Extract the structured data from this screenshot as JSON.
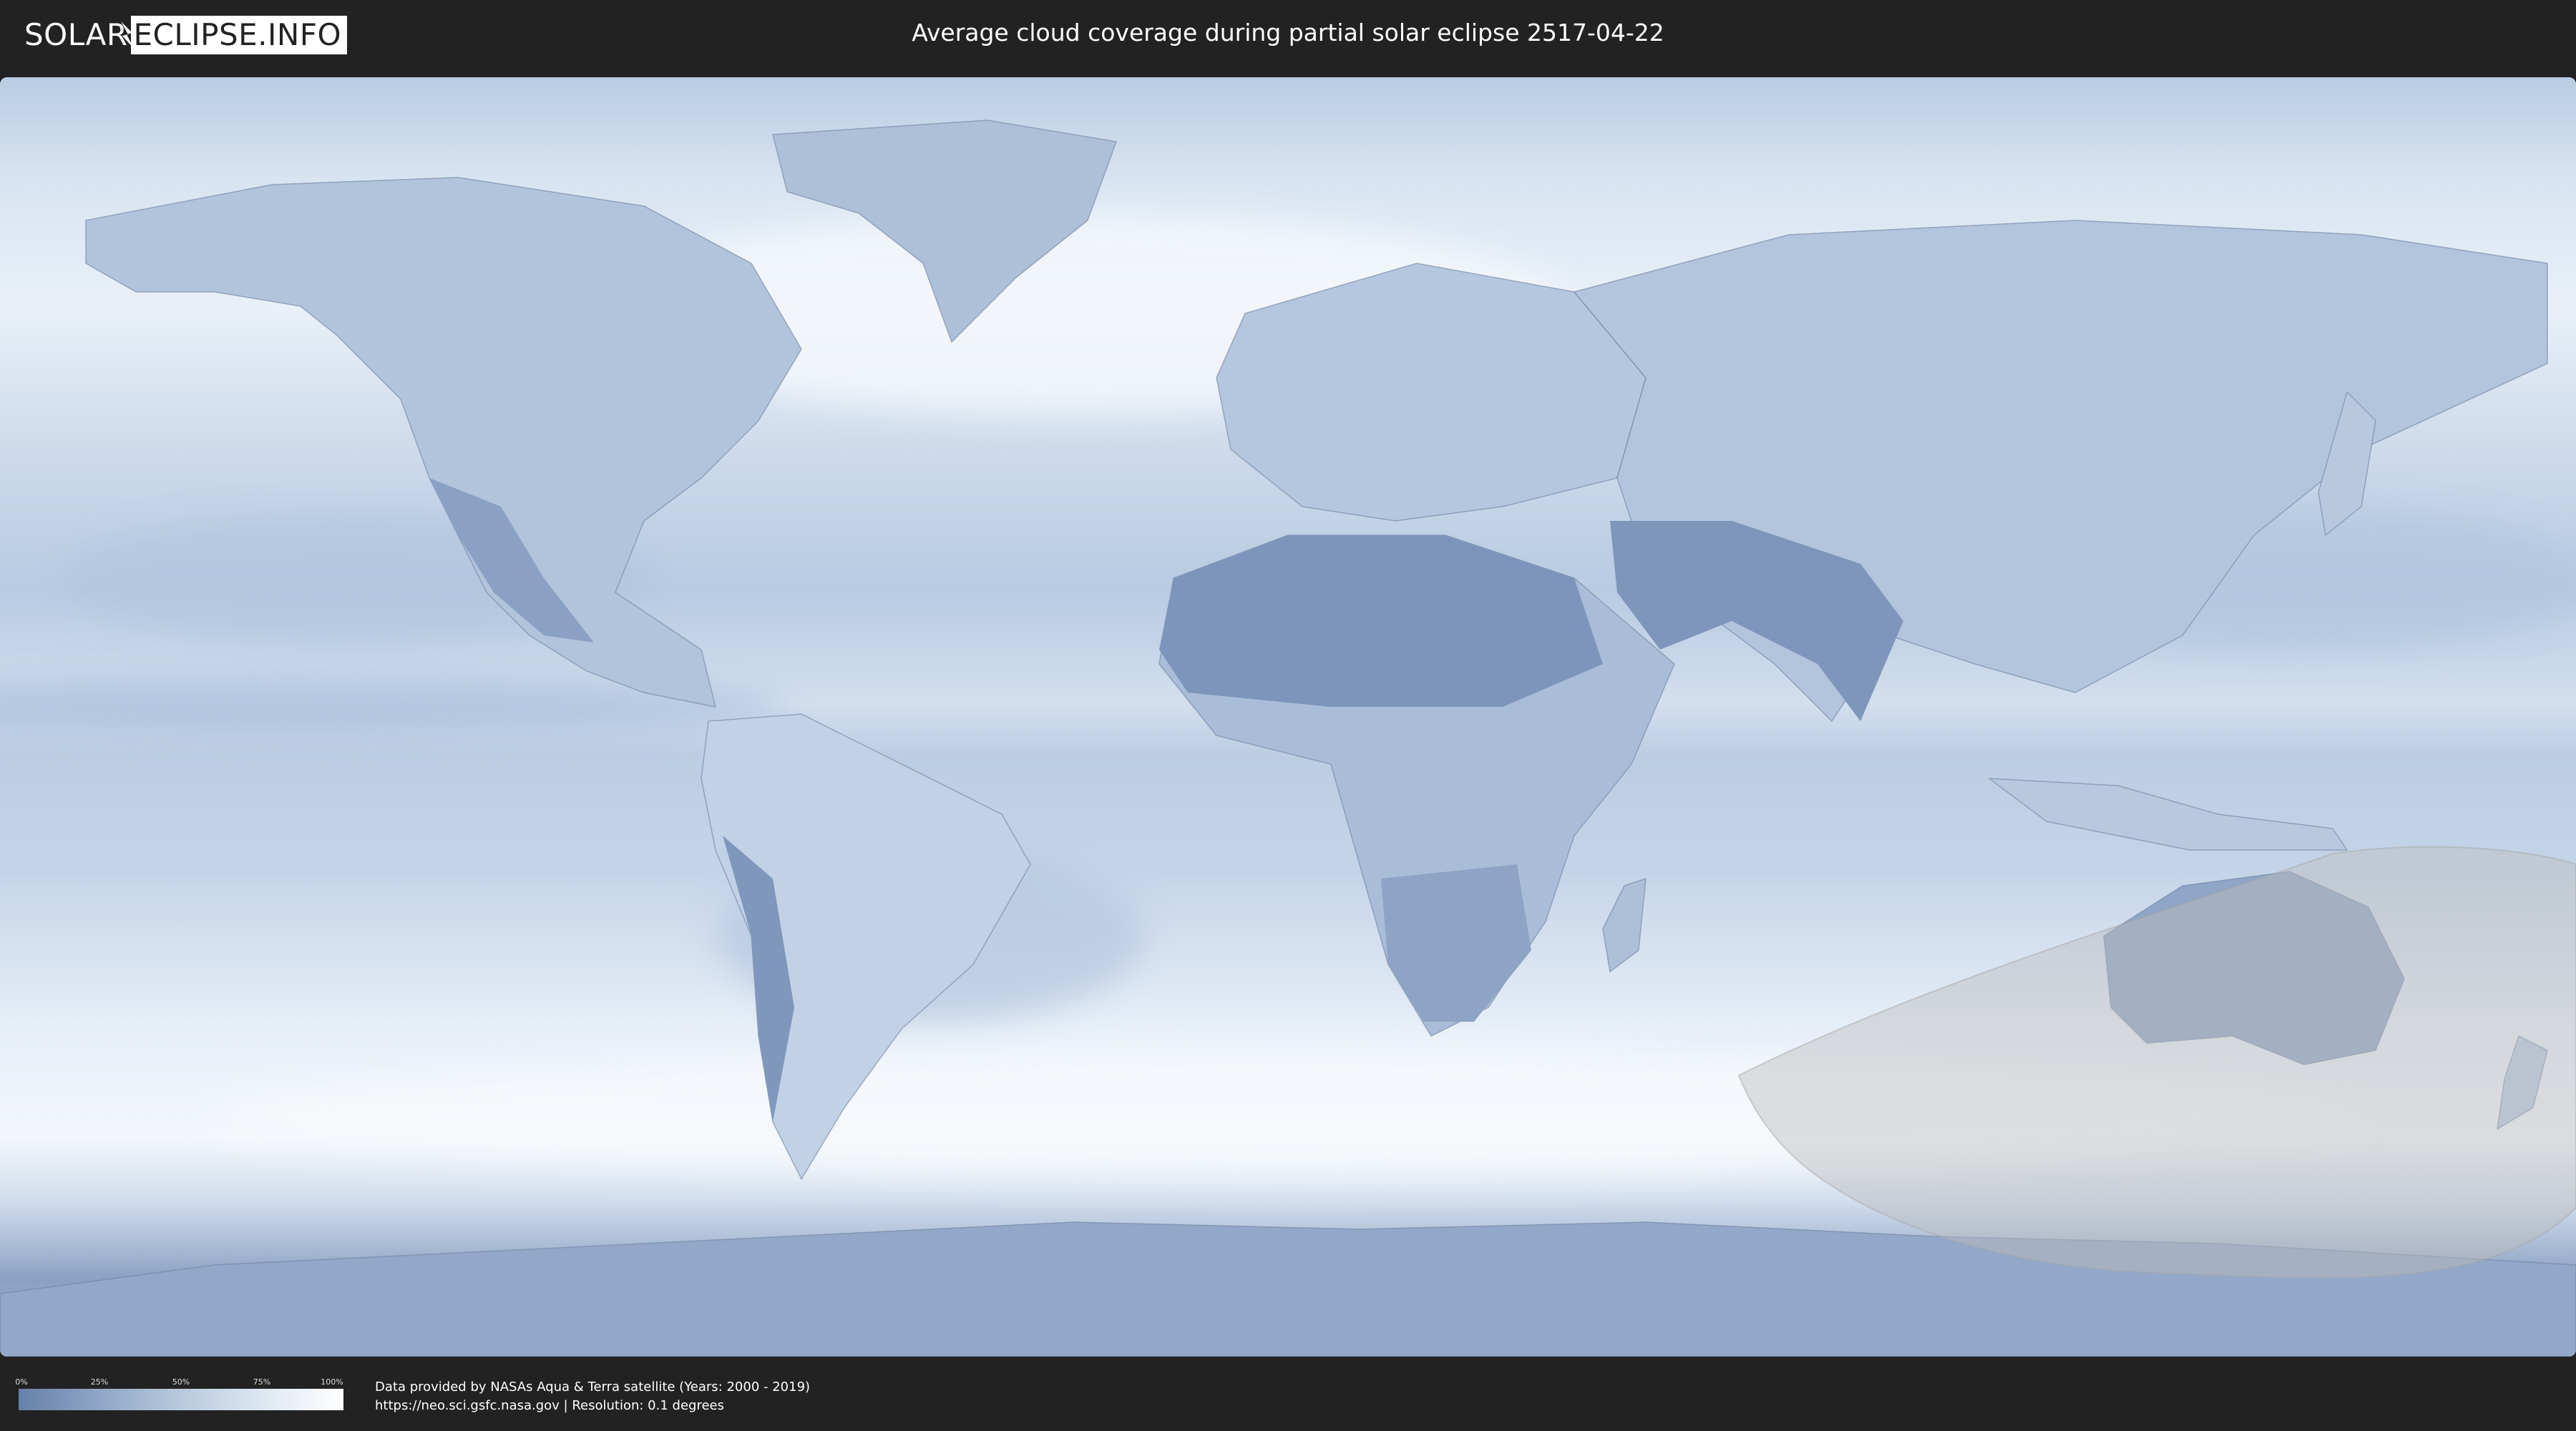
{
  "header": {
    "logo_left": "SOLAR",
    "logo_right": "ECLIPSE.INFO",
    "title": "Average cloud coverage during partial solar eclipse 2517-04-22"
  },
  "legend": {
    "ticks": [
      "0%",
      "25%",
      "50%",
      "75%",
      "100%"
    ],
    "color_low": "#6680a8",
    "color_high": "#ffffff"
  },
  "credits": {
    "line1": "Data provided by NASAs Aqua & Terra satellite (Years: 2000 - 2019)",
    "line2": "https://neo.sci.gsfc.nasa.gov | Resolution: 0.1 degrees"
  },
  "colors": {
    "background": "#222222",
    "ocean_cloud": "#c8d8ea",
    "clear_sky": "#7a92b8",
    "eclipse_shade": "#bdbdbd"
  }
}
